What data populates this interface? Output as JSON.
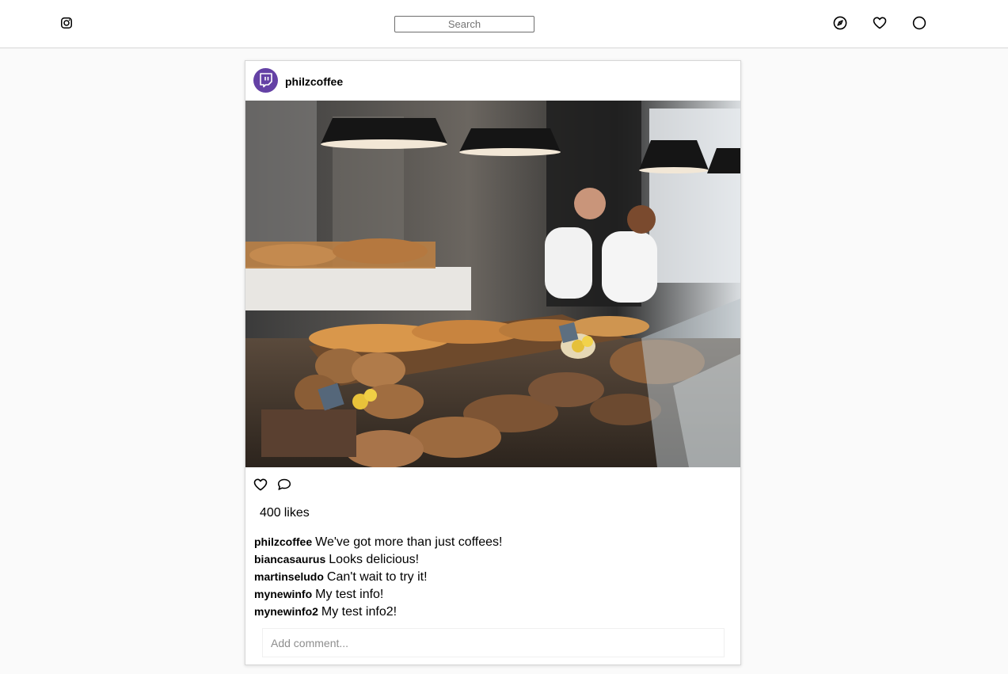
{
  "header": {
    "search_placeholder": "Search"
  },
  "post": {
    "username": "philzcoffee",
    "avatar": "twitch-logo",
    "image_alt": "Bakery counter with pastries and bread",
    "likes_count": "400",
    "likes_label": "likes",
    "comments": [
      {
        "user": "philzcoffee",
        "text": "We've got more than just coffees!"
      },
      {
        "user": "biancasaurus",
        "text": "Looks delicious!"
      },
      {
        "user": "martinseludo",
        "text": "Can't wait to try it!"
      },
      {
        "user": "mynewinfo",
        "text": "My test info!"
      },
      {
        "user": "mynewinfo2",
        "text": "My test info2!"
      }
    ],
    "add_comment_placeholder": "Add comment..."
  },
  "colors": {
    "avatar_bg": "#6441a5",
    "page_bg": "#fafafa"
  }
}
